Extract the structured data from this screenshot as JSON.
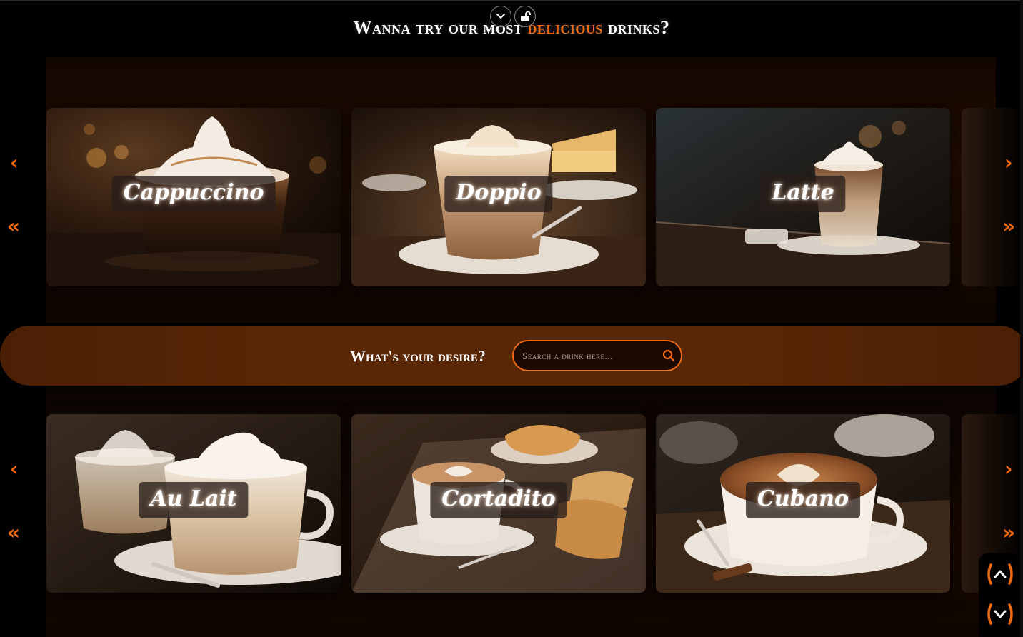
{
  "header": {
    "title_before": "Wanna try our most ",
    "title_accent": "delicious",
    "title_after": " drinks?",
    "accent_color": "#f06a13"
  },
  "top_controls": [
    {
      "icon": "chevron-down-icon"
    },
    {
      "icon": "unlock-icon"
    }
  ],
  "carousels": {
    "top": {
      "cards": [
        {
          "label": "Cappuccino"
        },
        {
          "label": "Doppio"
        },
        {
          "label": "Latte"
        }
      ]
    },
    "bottom": {
      "cards": [
        {
          "label": "Au Lait"
        },
        {
          "label": "Cortadito"
        },
        {
          "label": "Cubano"
        }
      ]
    },
    "nav": {
      "prev": "‹",
      "first": "«",
      "next": "›",
      "last": "»"
    }
  },
  "search": {
    "label": "What's your desire?",
    "placeholder": "Search a drink here...",
    "icon": "search-icon"
  },
  "scroll_controls": [
    {
      "icon": "scroll-up-icon"
    },
    {
      "icon": "scroll-down-icon"
    }
  ]
}
